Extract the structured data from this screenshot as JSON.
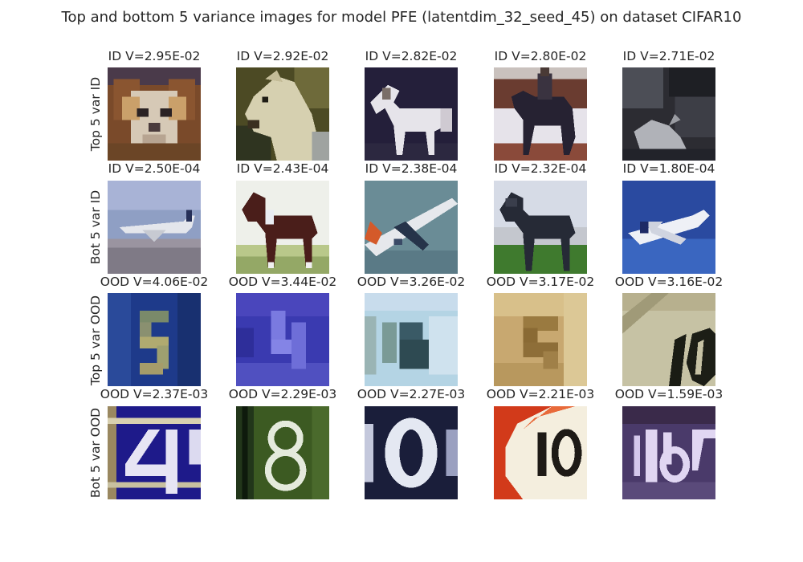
{
  "figure": {
    "title": "Top and bottom 5 variance images for model PFE (latentdim_32_seed_45) on dataset CIFAR10"
  },
  "rows": [
    {
      "label": "Top 5 var ID",
      "cells": [
        {
          "title": "ID V=2.95E-02",
          "image": "dog-face-thumbnail"
        },
        {
          "title": "ID V=2.92E-02",
          "image": "horse-head-thumbnail"
        },
        {
          "title": "ID V=2.82E-02",
          "image": "white-horse-thumbnail"
        },
        {
          "title": "ID V=2.80E-02",
          "image": "horse-rider-thumbnail"
        },
        {
          "title": "ID V=2.71E-02",
          "image": "cat-dark-thumbnail"
        }
      ]
    },
    {
      "label": "Bot 5 var ID",
      "cells": [
        {
          "title": "ID V=2.50E-04",
          "image": "airliner-thumbnail"
        },
        {
          "title": "ID V=2.43E-04",
          "image": "brown-horse-thumbnail"
        },
        {
          "title": "ID V=2.38E-04",
          "image": "airplane-tilted-thumbnail"
        },
        {
          "title": "ID V=2.32E-04",
          "image": "dark-horse-thumbnail"
        },
        {
          "title": "ID V=1.80E-04",
          "image": "airliner-blue-sky-thumbnail"
        }
      ]
    },
    {
      "label": "Top 5 var OOD",
      "cells": [
        {
          "title": "OOD V=4.06E-02",
          "image": "blurry-digit-5-thumbnail"
        },
        {
          "title": "OOD V=3.44E-02",
          "image": "blurry-digit-4-thumbnail"
        },
        {
          "title": "OOD V=3.26E-02",
          "image": "blurry-digit-pale-thumbnail"
        },
        {
          "title": "OOD V=3.17E-02",
          "image": "blurry-digit-tan-thumbnail"
        },
        {
          "title": "OOD V=3.16E-02",
          "image": "digit-10-thumbnail"
        }
      ]
    },
    {
      "label": "Bot 5 var OOD",
      "cells": [
        {
          "title": "OOD V=2.37E-03",
          "image": "digit-4-blue-thumbnail"
        },
        {
          "title": "OOD V=2.29E-03",
          "image": "digit-8-green-thumbnail"
        },
        {
          "title": "OOD V=2.27E-03",
          "image": "digit-0-navy-thumbnail"
        },
        {
          "title": "OOD V=2.21E-03",
          "image": "digit-10-red-sign-thumbnail"
        },
        {
          "title": "OOD V=1.59E-03",
          "image": "digit-16-purple-thumbnail"
        }
      ]
    }
  ]
}
